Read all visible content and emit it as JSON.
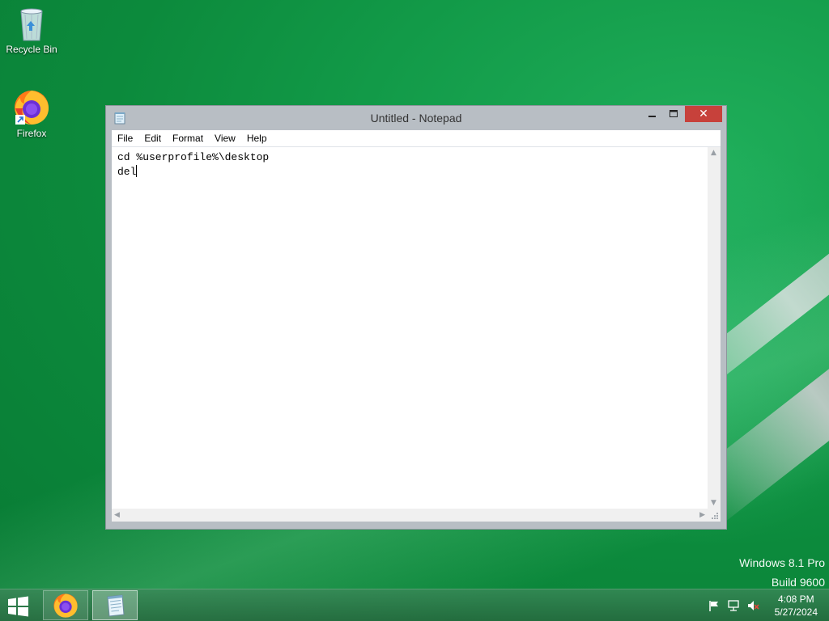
{
  "desktop": {
    "icons": [
      {
        "label": "Recycle Bin",
        "icon": "recycle-bin-icon"
      },
      {
        "label": "Firefox",
        "icon": "firefox-icon"
      }
    ],
    "watermark": {
      "line1": "Windows 8.1 Pro",
      "line2": "Build 9600"
    }
  },
  "notepad": {
    "title": "Untitled - Notepad",
    "close_symbol": "✕",
    "menu": [
      "File",
      "Edit",
      "Format",
      "View",
      "Help"
    ],
    "content_lines": [
      "cd %userprofile%\\desktop",
      "del"
    ]
  },
  "taskbar": {
    "apps": [
      {
        "name": "Firefox",
        "icon": "firefox-icon",
        "active": false
      },
      {
        "name": "Notepad",
        "icon": "notepad-icon",
        "active": true
      }
    ],
    "tray": [
      "action-center-flag-icon",
      "network-icon",
      "volume-muted-icon"
    ],
    "clock": {
      "time": "4:08 PM",
      "date": "5/27/2024"
    }
  },
  "colors": {
    "desktop_green": "#109a48",
    "close_button": "#c7413b",
    "window_frame": "#b8bec4"
  }
}
